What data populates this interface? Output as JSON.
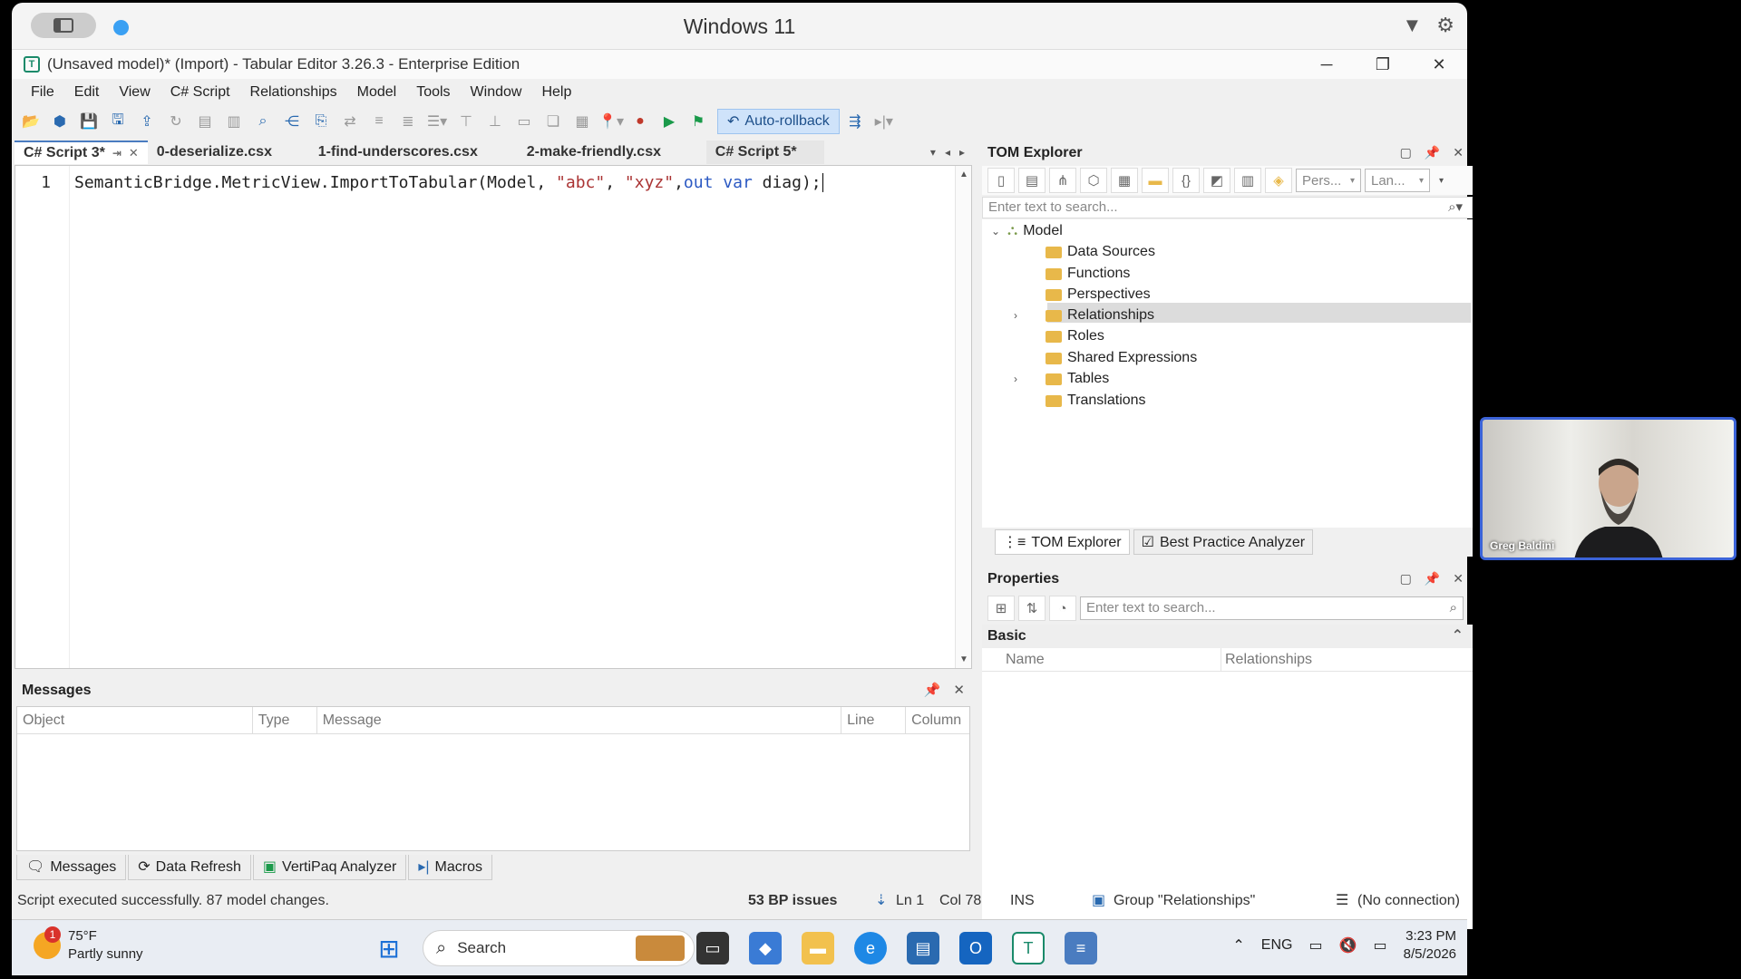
{
  "vm": {
    "title": "Windows 11"
  },
  "window": {
    "title": "(Unsaved model)* (Import) - Tabular Editor 3.26.3 - Enterprise Edition"
  },
  "menu": [
    "File",
    "Edit",
    "View",
    "C# Script",
    "Relationships",
    "Model",
    "Tools",
    "Window",
    "Help"
  ],
  "toolbar": {
    "autorollback_label": "Auto-rollback"
  },
  "doc_tabs": [
    "C# Script 3*",
    "0-deserialize.csx",
    "1-find-underscores.csx",
    "2-make-friendly.csx",
    "C# Script 5*"
  ],
  "editor": {
    "line_number": "1",
    "code": {
      "p1": "SemanticBridge.MetricView.ImportToTabular(Model, ",
      "s1": "\"abc\"",
      "p2": ", ",
      "s2": "\"xyz\"",
      "p3": ",",
      "k1": "out var",
      "p4": " diag);"
    }
  },
  "messages": {
    "title": "Messages",
    "columns": [
      "Object",
      "Type",
      "Message",
      "Line",
      "Column"
    ]
  },
  "bottom_tabs": [
    "Messages",
    "Data Refresh",
    "VertiPaq Analyzer",
    "Macros"
  ],
  "tom": {
    "title": "TOM Explorer",
    "search_placeholder": "Enter text to search...",
    "perspective_dd": "Pers...",
    "language_dd": "Lan...",
    "root": "Model",
    "items": [
      "Data Sources",
      "Functions",
      "Perspectives",
      "Relationships",
      "Roles",
      "Shared Expressions",
      "Tables",
      "Translations"
    ],
    "tabs": [
      "TOM Explorer",
      "Best Practice Analyzer"
    ]
  },
  "properties": {
    "title": "Properties",
    "search_placeholder": "Enter text to search...",
    "category": "Basic",
    "name_label": "Name",
    "name_value": "Relationships"
  },
  "status": {
    "message": "Script executed successfully. 87 model changes.",
    "bp_issues": "53 BP issues",
    "ln": "Ln 1",
    "col": "Col 78",
    "ins": "INS",
    "group": "Group \"Relationships\"",
    "connection": "(No connection)"
  },
  "taskbar": {
    "temperature": "75°F",
    "weather": "Partly sunny",
    "weather_badge": "1",
    "search": "Search",
    "lang": "ENG",
    "time": "3:23 PM",
    "date": "8/5/2026"
  },
  "webcam": {
    "name": "Greg Baldini"
  },
  "colors": {
    "accent": "#3b63d8",
    "selection": "#dcdcdc",
    "string": "#aa3333",
    "keyword": "#2b59c3"
  }
}
